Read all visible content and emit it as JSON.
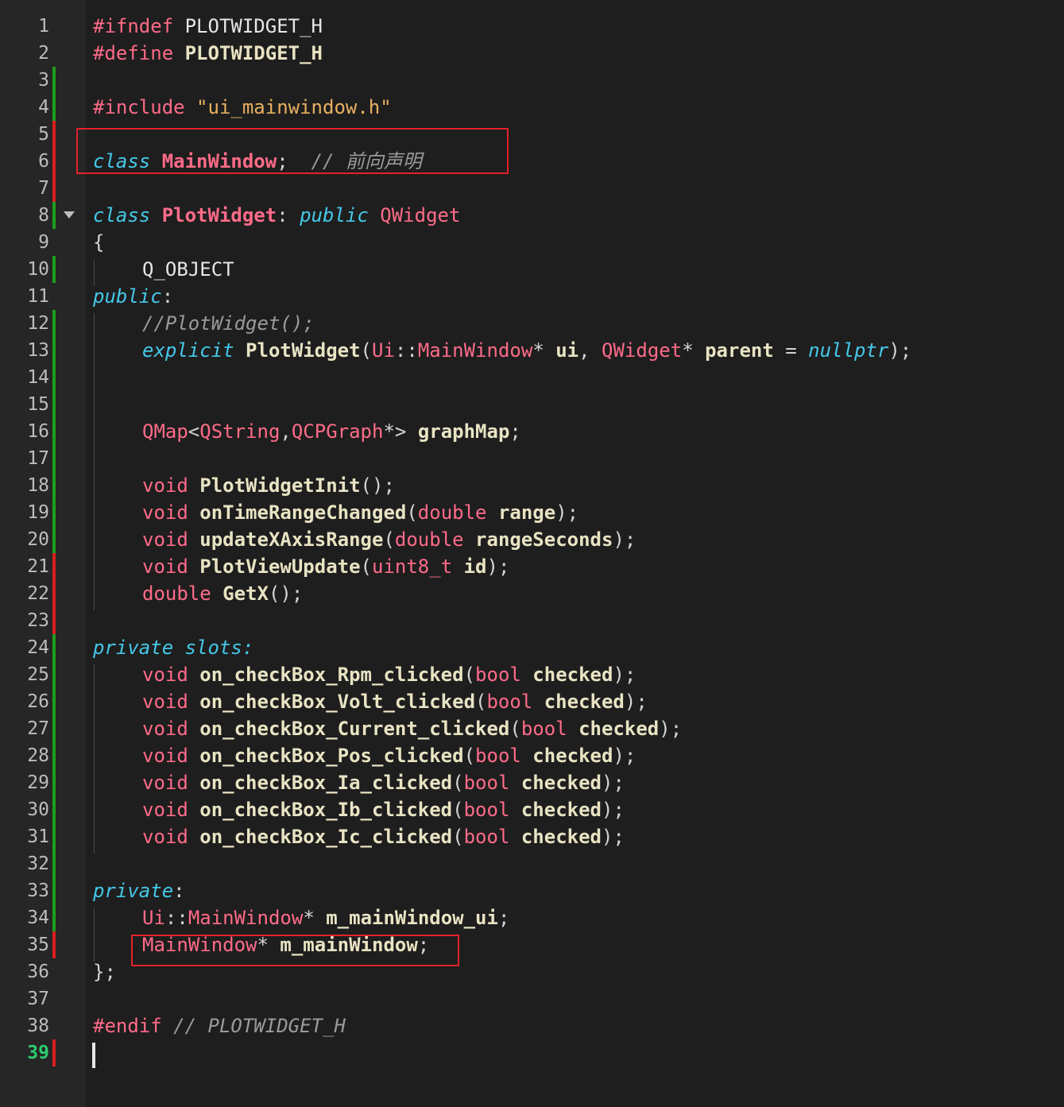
{
  "editor": {
    "current_line": 39,
    "colors": {
      "background": "#1e1e1e",
      "gutter": "#262626",
      "modified": "#1f9d1f",
      "unsaved": "#d81e1e",
      "highlight_box": "#e3222a"
    },
    "lines": [
      {
        "num": "1",
        "mark": "none",
        "fold": false,
        "indent": 0,
        "tokens": [
          {
            "t": "#ifndef",
            "c": "pp"
          },
          {
            "t": " PLOTWIDGET_H",
            "c": "mac"
          }
        ]
      },
      {
        "num": "2",
        "mark": "none",
        "fold": false,
        "indent": 0,
        "tokens": [
          {
            "t": "#define",
            "c": "pp"
          },
          {
            "t": " "
          },
          {
            "t": "PLOTWIDGET_H",
            "c": "id"
          }
        ]
      },
      {
        "num": "3",
        "mark": "green",
        "fold": false,
        "indent": 0,
        "tokens": []
      },
      {
        "num": "4",
        "mark": "green",
        "fold": false,
        "indent": 0,
        "tokens": [
          {
            "t": "#include",
            "c": "pp"
          },
          {
            "t": " "
          },
          {
            "t": "\"ui_mainwindow.h\"",
            "c": "str"
          }
        ]
      },
      {
        "num": "5",
        "mark": "red",
        "fold": false,
        "indent": 0,
        "tokens": []
      },
      {
        "num": "6",
        "mark": "red",
        "fold": false,
        "indent": 0,
        "tokens": [
          {
            "t": "class",
            "c": "kw"
          },
          {
            "t": " "
          },
          {
            "t": "MainWindow",
            "c": "cls"
          },
          {
            "t": ";  ",
            "c": "pn"
          },
          {
            "t": "// 前向声明",
            "c": "cm"
          }
        ]
      },
      {
        "num": "7",
        "mark": "red",
        "fold": false,
        "indent": 0,
        "tokens": []
      },
      {
        "num": "8",
        "mark": "green",
        "fold": true,
        "indent": 0,
        "tokens": [
          {
            "t": "class",
            "c": "kw"
          },
          {
            "t": " "
          },
          {
            "t": "PlotWidget",
            "c": "cls"
          },
          {
            "t": ": ",
            "c": "pn"
          },
          {
            "t": "public",
            "c": "kw"
          },
          {
            "t": " "
          },
          {
            "t": "QWidget",
            "c": "tp"
          }
        ]
      },
      {
        "num": "9",
        "mark": "none",
        "fold": false,
        "indent": 0,
        "tokens": [
          {
            "t": "{",
            "c": "pn"
          }
        ]
      },
      {
        "num": "10",
        "mark": "green",
        "fold": false,
        "indent": 1,
        "tokens": [
          {
            "t": "Q_OBJECT",
            "c": "mac"
          }
        ]
      },
      {
        "num": "11",
        "mark": "none",
        "fold": false,
        "indent": 0,
        "tokens": [
          {
            "t": "public",
            "c": "kw"
          },
          {
            "t": ":",
            "c": "pn"
          }
        ]
      },
      {
        "num": "12",
        "mark": "green",
        "fold": false,
        "indent": 1,
        "tokens": [
          {
            "t": "//PlotWidget();",
            "c": "cm"
          }
        ]
      },
      {
        "num": "13",
        "mark": "green",
        "fold": false,
        "indent": 1,
        "tokens": [
          {
            "t": "explicit",
            "c": "kw"
          },
          {
            "t": " "
          },
          {
            "t": "PlotWidget",
            "c": "fn"
          },
          {
            "t": "(",
            "c": "pn"
          },
          {
            "t": "Ui",
            "c": "tp"
          },
          {
            "t": "::",
            "c": "pn"
          },
          {
            "t": "MainWindow",
            "c": "tp"
          },
          {
            "t": "* ",
            "c": "pn"
          },
          {
            "t": "ui",
            "c": "id"
          },
          {
            "t": ", ",
            "c": "pn"
          },
          {
            "t": "QWidget",
            "c": "tp"
          },
          {
            "t": "* ",
            "c": "pn"
          },
          {
            "t": "parent",
            "c": "id"
          },
          {
            "t": " = ",
            "c": "pn"
          },
          {
            "t": "nullptr",
            "c": "kw"
          },
          {
            "t": ");",
            "c": "pn"
          }
        ]
      },
      {
        "num": "14",
        "mark": "green",
        "fold": false,
        "indent": 1,
        "tokens": []
      },
      {
        "num": "15",
        "mark": "green",
        "fold": false,
        "indent": 1,
        "tokens": []
      },
      {
        "num": "16",
        "mark": "green",
        "fold": false,
        "indent": 1,
        "tokens": [
          {
            "t": "QMap",
            "c": "tp"
          },
          {
            "t": "<",
            "c": "pn"
          },
          {
            "t": "QString",
            "c": "tp"
          },
          {
            "t": ",",
            "c": "pn"
          },
          {
            "t": "QCPGraph",
            "c": "tp"
          },
          {
            "t": "*> ",
            "c": "pn"
          },
          {
            "t": "graphMap",
            "c": "id"
          },
          {
            "t": ";",
            "c": "pn"
          }
        ]
      },
      {
        "num": "17",
        "mark": "green",
        "fold": false,
        "indent": 1,
        "tokens": []
      },
      {
        "num": "18",
        "mark": "green",
        "fold": false,
        "indent": 1,
        "tokens": [
          {
            "t": "void",
            "c": "tp"
          },
          {
            "t": " "
          },
          {
            "t": "PlotWidgetInit",
            "c": "fn"
          },
          {
            "t": "();",
            "c": "pn"
          }
        ]
      },
      {
        "num": "19",
        "mark": "green",
        "fold": false,
        "indent": 1,
        "tokens": [
          {
            "t": "void",
            "c": "tp"
          },
          {
            "t": " "
          },
          {
            "t": "onTimeRangeChanged",
            "c": "fn"
          },
          {
            "t": "(",
            "c": "pn"
          },
          {
            "t": "double",
            "c": "tp"
          },
          {
            "t": " "
          },
          {
            "t": "range",
            "c": "id"
          },
          {
            "t": ");",
            "c": "pn"
          }
        ]
      },
      {
        "num": "20",
        "mark": "green",
        "fold": false,
        "indent": 1,
        "tokens": [
          {
            "t": "void",
            "c": "tp"
          },
          {
            "t": " "
          },
          {
            "t": "updateXAxisRange",
            "c": "fn"
          },
          {
            "t": "(",
            "c": "pn"
          },
          {
            "t": "double",
            "c": "tp"
          },
          {
            "t": " "
          },
          {
            "t": "rangeSeconds",
            "c": "id"
          },
          {
            "t": ");",
            "c": "pn"
          }
        ]
      },
      {
        "num": "21",
        "mark": "red",
        "fold": false,
        "indent": 1,
        "tokens": [
          {
            "t": "void",
            "c": "tp"
          },
          {
            "t": " "
          },
          {
            "t": "PlotViewUpdate",
            "c": "fn"
          },
          {
            "t": "(",
            "c": "pn"
          },
          {
            "t": "uint8_t",
            "c": "tp"
          },
          {
            "t": " "
          },
          {
            "t": "id",
            "c": "id"
          },
          {
            "t": ");",
            "c": "pn"
          }
        ]
      },
      {
        "num": "22",
        "mark": "red",
        "fold": false,
        "indent": 1,
        "tokens": [
          {
            "t": "double",
            "c": "tp"
          },
          {
            "t": " "
          },
          {
            "t": "GetX",
            "c": "fn"
          },
          {
            "t": "();",
            "c": "pn"
          }
        ]
      },
      {
        "num": "23",
        "mark": "red",
        "fold": false,
        "indent": 0,
        "tokens": []
      },
      {
        "num": "24",
        "mark": "green",
        "fold": false,
        "indent": 0,
        "tokens": [
          {
            "t": "private",
            "c": "kw"
          },
          {
            "t": " "
          },
          {
            "t": "slots:",
            "c": "kwn"
          }
        ]
      },
      {
        "num": "25",
        "mark": "green",
        "fold": false,
        "indent": 1,
        "tokens": [
          {
            "t": "void",
            "c": "tp"
          },
          {
            "t": " "
          },
          {
            "t": "on_checkBox_Rpm_clicked",
            "c": "fn"
          },
          {
            "t": "(",
            "c": "pn"
          },
          {
            "t": "bool",
            "c": "tp"
          },
          {
            "t": " "
          },
          {
            "t": "checked",
            "c": "id"
          },
          {
            "t": ");",
            "c": "pn"
          }
        ]
      },
      {
        "num": "26",
        "mark": "green",
        "fold": false,
        "indent": 1,
        "tokens": [
          {
            "t": "void",
            "c": "tp"
          },
          {
            "t": " "
          },
          {
            "t": "on_checkBox_Volt_clicked",
            "c": "fn"
          },
          {
            "t": "(",
            "c": "pn"
          },
          {
            "t": "bool",
            "c": "tp"
          },
          {
            "t": " "
          },
          {
            "t": "checked",
            "c": "id"
          },
          {
            "t": ");",
            "c": "pn"
          }
        ]
      },
      {
        "num": "27",
        "mark": "green",
        "fold": false,
        "indent": 1,
        "tokens": [
          {
            "t": "void",
            "c": "tp"
          },
          {
            "t": " "
          },
          {
            "t": "on_checkBox_Current_clicked",
            "c": "fn"
          },
          {
            "t": "(",
            "c": "pn"
          },
          {
            "t": "bool",
            "c": "tp"
          },
          {
            "t": " "
          },
          {
            "t": "checked",
            "c": "id"
          },
          {
            "t": ");",
            "c": "pn"
          }
        ]
      },
      {
        "num": "28",
        "mark": "green",
        "fold": false,
        "indent": 1,
        "tokens": [
          {
            "t": "void",
            "c": "tp"
          },
          {
            "t": " "
          },
          {
            "t": "on_checkBox_Pos_clicked",
            "c": "fn"
          },
          {
            "t": "(",
            "c": "pn"
          },
          {
            "t": "bool",
            "c": "tp"
          },
          {
            "t": " "
          },
          {
            "t": "checked",
            "c": "id"
          },
          {
            "t": ");",
            "c": "pn"
          }
        ]
      },
      {
        "num": "29",
        "mark": "green",
        "fold": false,
        "indent": 1,
        "tokens": [
          {
            "t": "void",
            "c": "tp"
          },
          {
            "t": " "
          },
          {
            "t": "on_checkBox_Ia_clicked",
            "c": "fn"
          },
          {
            "t": "(",
            "c": "pn"
          },
          {
            "t": "bool",
            "c": "tp"
          },
          {
            "t": " "
          },
          {
            "t": "checked",
            "c": "id"
          },
          {
            "t": ");",
            "c": "pn"
          }
        ]
      },
      {
        "num": "30",
        "mark": "green",
        "fold": false,
        "indent": 1,
        "tokens": [
          {
            "t": "void",
            "c": "tp"
          },
          {
            "t": " "
          },
          {
            "t": "on_checkBox_Ib_clicked",
            "c": "fn"
          },
          {
            "t": "(",
            "c": "pn"
          },
          {
            "t": "bool",
            "c": "tp"
          },
          {
            "t": " "
          },
          {
            "t": "checked",
            "c": "id"
          },
          {
            "t": ");",
            "c": "pn"
          }
        ]
      },
      {
        "num": "31",
        "mark": "green",
        "fold": false,
        "indent": 1,
        "tokens": [
          {
            "t": "void",
            "c": "tp"
          },
          {
            "t": " "
          },
          {
            "t": "on_checkBox_Ic_clicked",
            "c": "fn"
          },
          {
            "t": "(",
            "c": "pn"
          },
          {
            "t": "bool",
            "c": "tp"
          },
          {
            "t": " "
          },
          {
            "t": "checked",
            "c": "id"
          },
          {
            "t": ");",
            "c": "pn"
          }
        ]
      },
      {
        "num": "32",
        "mark": "green",
        "fold": false,
        "indent": 0,
        "tokens": []
      },
      {
        "num": "33",
        "mark": "green",
        "fold": false,
        "indent": 0,
        "tokens": [
          {
            "t": "private",
            "c": "kw"
          },
          {
            "t": ":",
            "c": "pn"
          }
        ]
      },
      {
        "num": "34",
        "mark": "green",
        "fold": false,
        "indent": 1,
        "tokens": [
          {
            "t": "Ui",
            "c": "tp"
          },
          {
            "t": "::",
            "c": "pn"
          },
          {
            "t": "MainWindow",
            "c": "tp"
          },
          {
            "t": "* ",
            "c": "pn"
          },
          {
            "t": "m_mainWindow_ui",
            "c": "id"
          },
          {
            "t": ";",
            "c": "pn"
          }
        ]
      },
      {
        "num": "35",
        "mark": "red",
        "fold": false,
        "indent": 1,
        "tokens": [
          {
            "t": "MainWindow",
            "c": "tp"
          },
          {
            "t": "* ",
            "c": "pn"
          },
          {
            "t": "m_mainWindow",
            "c": "id"
          },
          {
            "t": ";",
            "c": "pn"
          }
        ]
      },
      {
        "num": "36",
        "mark": "none",
        "fold": false,
        "indent": 0,
        "tokens": [
          {
            "t": "};",
            "c": "pn"
          }
        ]
      },
      {
        "num": "37",
        "mark": "none",
        "fold": false,
        "indent": 0,
        "tokens": []
      },
      {
        "num": "38",
        "mark": "none",
        "fold": false,
        "indent": 0,
        "tokens": [
          {
            "t": "#endif",
            "c": "pp"
          },
          {
            "t": " "
          },
          {
            "t": "// PLOTWIDGET_H",
            "c": "cm"
          }
        ]
      },
      {
        "num": "39",
        "mark": "red",
        "fold": false,
        "indent": 0,
        "tokens": []
      }
    ]
  }
}
